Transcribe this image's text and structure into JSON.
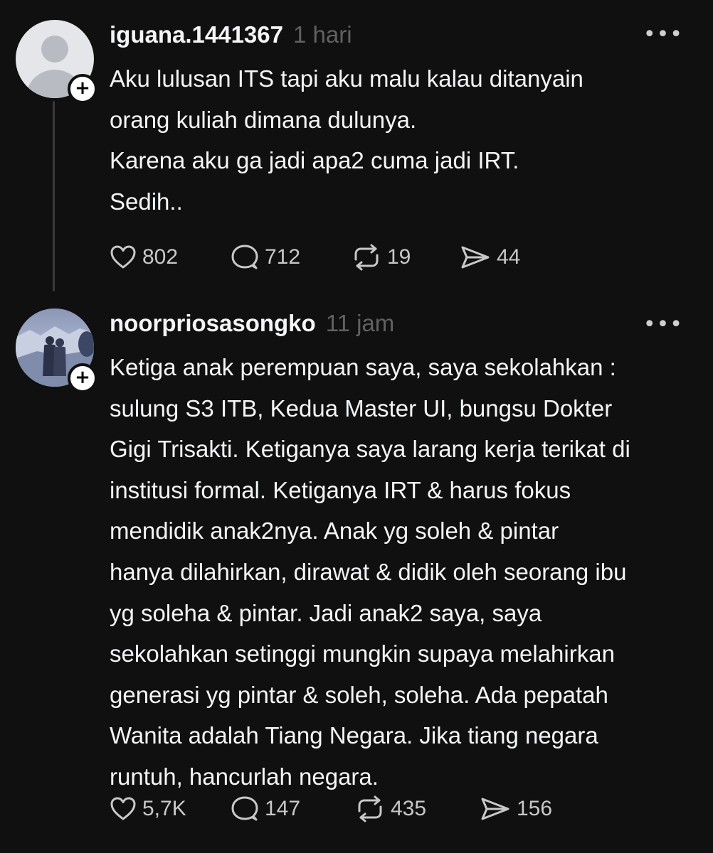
{
  "posts": [
    {
      "username": "iguana.1441367",
      "timestamp": "1 hari",
      "text": "Aku lulusan ITS tapi aku malu kalau ditanyain\norang kuliah dimana dulunya.\nKarena aku ga jadi apa2 cuma jadi IRT.\nSedih..",
      "likes": "802",
      "replies": "712",
      "reposts": "19",
      "shares": "44",
      "follow_icon": "+",
      "more_icon": "•••"
    },
    {
      "username": "noorpriosasongko",
      "timestamp": "11 jam",
      "text": "Ketiga anak perempuan saya, saya sekolahkan :\nsulung S3 ITB, Kedua Master UI, bungsu Dokter\nGigi Trisakti. Ketiganya saya larang kerja terikat di\ninstitusi formal. Ketiganya IRT & harus fokus\nmendidik anak2nya. Anak yg soleh & pintar\nhanya dilahirkan, dirawat & didik oleh seorang ibu\nyg soleha & pintar. Jadi anak2 saya, saya\nsekolahkan setinggi mungkin supaya melahirkan\ngenerasi yg pintar & soleh, soleha. Ada pepatah\nWanita adalah Tiang Negara. Jika tiang negara\nruntuh, hancurlah negara.",
      "likes": "5,7K",
      "replies": "147",
      "reposts": "435",
      "shares": "156",
      "follow_icon": "+",
      "more_icon": "•••"
    }
  ],
  "colors": {
    "background": "#101010",
    "primary_text": "#f3f5f7",
    "secondary_text": "#616161",
    "icon": "#c8c8c8",
    "thread_line": "#3a3a3a"
  },
  "icons": {
    "like": "heart-icon",
    "reply": "comment-bubble-icon",
    "repost": "repost-arrows-icon",
    "share": "send-icon",
    "more": "more-horizontal-icon",
    "follow": "plus-icon"
  }
}
